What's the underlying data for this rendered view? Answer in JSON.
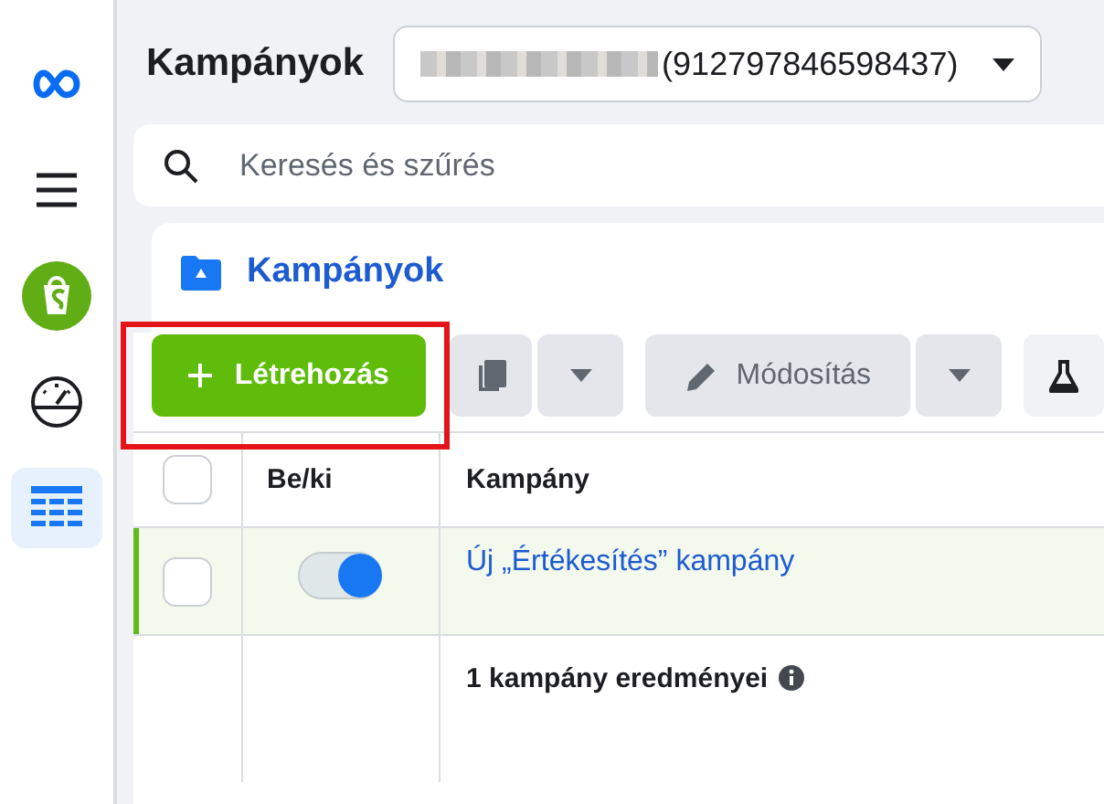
{
  "sidebar": {
    "items": [
      {
        "kind": "logo",
        "selected": false
      },
      {
        "kind": "menu",
        "selected": false
      },
      {
        "kind": "shop",
        "selected": false
      },
      {
        "kind": "gauge",
        "selected": false
      },
      {
        "kind": "table",
        "selected": true
      }
    ]
  },
  "header": {
    "title": "Kampányok",
    "account_id": "(912797846598437)"
  },
  "search": {
    "placeholder": "Keresés és szűrés"
  },
  "card": {
    "title": "Kampányok"
  },
  "toolbar": {
    "create": {
      "label": "Létrehozás",
      "highlighted": true
    },
    "edit": "Módosítás"
  },
  "table": {
    "columns": [
      "Be/ki",
      "Kampány"
    ],
    "all_checked": false,
    "rows": [
      {
        "name": "Új „Értékesítés” kampány",
        "checked": false,
        "on": true,
        "highlighted": true
      }
    ],
    "summary": "1 kampány eredményei"
  }
}
